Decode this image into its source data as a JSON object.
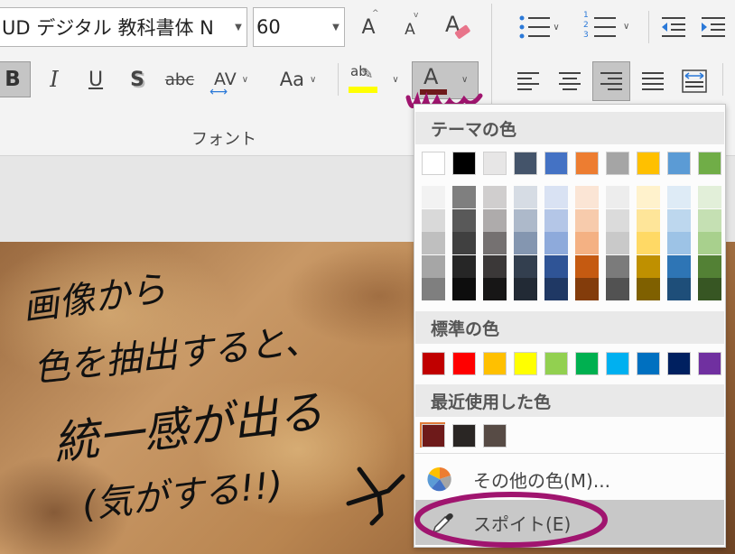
{
  "ribbon": {
    "font_name": "UD デジタル 教科書体 N",
    "font_size": "60",
    "group_label": "フォント",
    "bold_label": "B",
    "italic_label": "I",
    "underline_label": "U",
    "shadow_label": "S",
    "strike_label": "abc",
    "spacing_label": "AV",
    "case_label": "Aa",
    "highlight_label": "ab",
    "fontcolor_label": "A",
    "grow_label": "A",
    "shrink_label": "A",
    "numbering_digits": [
      "1",
      "2",
      "3"
    ]
  },
  "colors": {
    "font_color": "#6e1a1a",
    "highlight": "#ffff00",
    "annotation": "#a0156f"
  },
  "panel": {
    "theme_heading": "テーマの色",
    "standard_heading": "標準の色",
    "recent_heading": "最近使用した色",
    "more_colors_label": "その他の色(M)...",
    "eyedropper_label": "スポイト(E)",
    "theme_top": [
      "#ffffff",
      "#000000",
      "#e7e6e6",
      "#44546a",
      "#4472c4",
      "#ed7d31",
      "#a5a5a5",
      "#ffc000",
      "#5b9bd5",
      "#70ad47"
    ],
    "theme_shades": [
      [
        "#f2f2f2",
        "#d9d9d9",
        "#bfbfbf",
        "#a6a6a6",
        "#7f7f7f"
      ],
      [
        "#7f7f7f",
        "#595959",
        "#404040",
        "#262626",
        "#0d0d0d"
      ],
      [
        "#d0cece",
        "#aeabab",
        "#757171",
        "#3b3838",
        "#171616"
      ],
      [
        "#d6dce4",
        "#adb9ca",
        "#8496b0",
        "#333f4f",
        "#222a35"
      ],
      [
        "#d9e2f3",
        "#b4c6e7",
        "#8eaadb",
        "#2f5496",
        "#1f3864"
      ],
      [
        "#fbe5d5",
        "#f7cbac",
        "#f4b183",
        "#c55a11",
        "#833c0b"
      ],
      [
        "#ededed",
        "#dbdbdb",
        "#c9c9c9",
        "#7b7b7b",
        "#525252"
      ],
      [
        "#fff2cc",
        "#fee599",
        "#ffd965",
        "#bf9000",
        "#7f6000"
      ],
      [
        "#deebf6",
        "#bdd7ee",
        "#9dc3e6",
        "#2e75b5",
        "#1e4e79"
      ],
      [
        "#e2efd9",
        "#c5e0b3",
        "#a8d08d",
        "#538135",
        "#375623"
      ]
    ],
    "standard": [
      "#c00000",
      "#ff0000",
      "#ffc000",
      "#ffff00",
      "#92d050",
      "#00b050",
      "#00b0f0",
      "#0070c0",
      "#002060",
      "#7030a0"
    ],
    "recent": [
      "#6e1a1a",
      "#2a2624",
      "#574b45"
    ]
  },
  "document": {
    "handwriting": [
      "画像から",
      "色を抽出すると、",
      "統一感が出る",
      "(気がする!!)"
    ]
  }
}
